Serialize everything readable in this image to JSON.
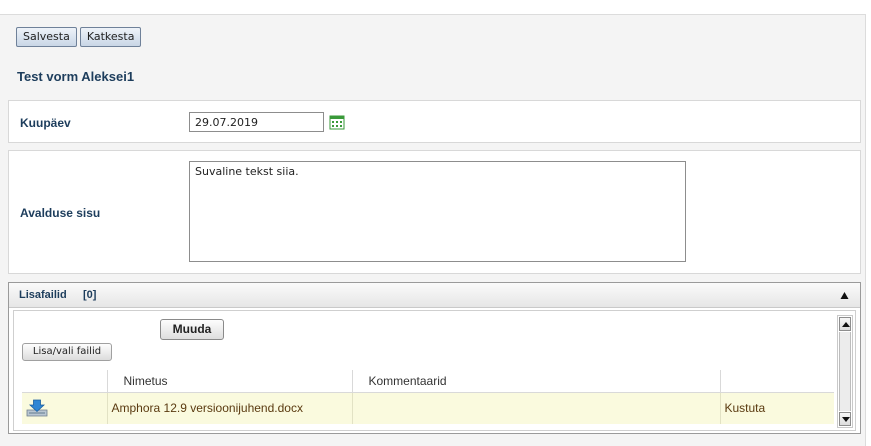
{
  "toolbar": {
    "save_label": "Salvesta",
    "cancel_label": "Katkesta"
  },
  "form": {
    "title": "Test vorm Aleksei1"
  },
  "date_field": {
    "label": "Kuupäev",
    "value": "29.07.2019",
    "icon": "calendar-icon"
  },
  "content_field": {
    "label": "Avalduse sisu",
    "value": "Suvaline tekst siia."
  },
  "attachments": {
    "title": "Lisafailid",
    "count": "[0]",
    "collapse_icon": "triangle-up-icon",
    "edit_label": "Muuda",
    "add_label": "Lisa/vali failid",
    "columns": [
      "",
      "Nimetus",
      "Kommentaarid",
      ""
    ],
    "rows": [
      {
        "icon": "download-icon",
        "name": "Amphora 12.9 versioonijuhend.docx",
        "comment": "",
        "action": "Kustuta"
      }
    ]
  },
  "colors": {
    "label_text": "#1d3d5c",
    "row_highlight": "#fafade",
    "calendar_green": "#3a9a3a"
  }
}
